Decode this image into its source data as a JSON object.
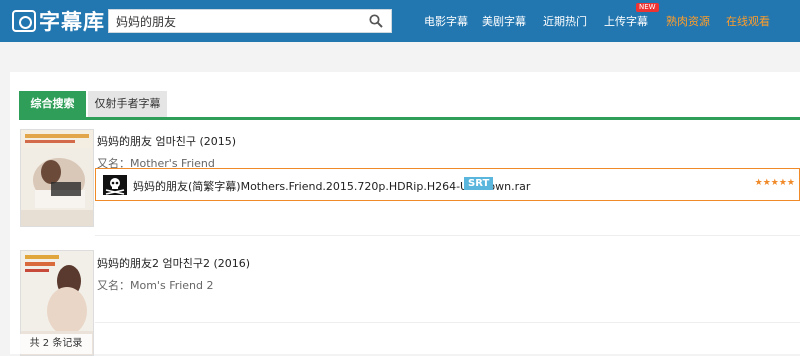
{
  "header": {
    "logo_text": "字幕库",
    "search_value": "妈妈的朋友",
    "nav": [
      {
        "label": "电影字幕"
      },
      {
        "label": "美剧字幕"
      },
      {
        "label": "近期热门"
      },
      {
        "label": "上传字幕",
        "badge": "NEW"
      },
      {
        "label": "熟肉资源"
      },
      {
        "label": "在线观看"
      }
    ]
  },
  "tabs": [
    {
      "label": "综合搜索"
    },
    {
      "label": "仅射手者字幕"
    }
  ],
  "results": [
    {
      "title": "妈妈的朋友 엄마친구 (2015)",
      "alias_label": "又名：",
      "alias": "Mother's Friend",
      "subtitle": {
        "filename": "妈妈的朋友(简繁字幕)Mothers.Friend.2015.720p.HDRip.H264-Unknown.rar",
        "format": "SRT",
        "rating": "★★★★★"
      }
    },
    {
      "title": "妈妈的朋友2 엄마친구2 (2016)",
      "alias_label": "又名：",
      "alias": "Mom's Friend 2"
    }
  ],
  "record_count": "共 2 条记录",
  "colors": {
    "header_bg": "#2377b0",
    "accent_green": "#2e9e58",
    "highlight_orange": "#f08a28",
    "srt_badge": "#5bb6dd"
  }
}
